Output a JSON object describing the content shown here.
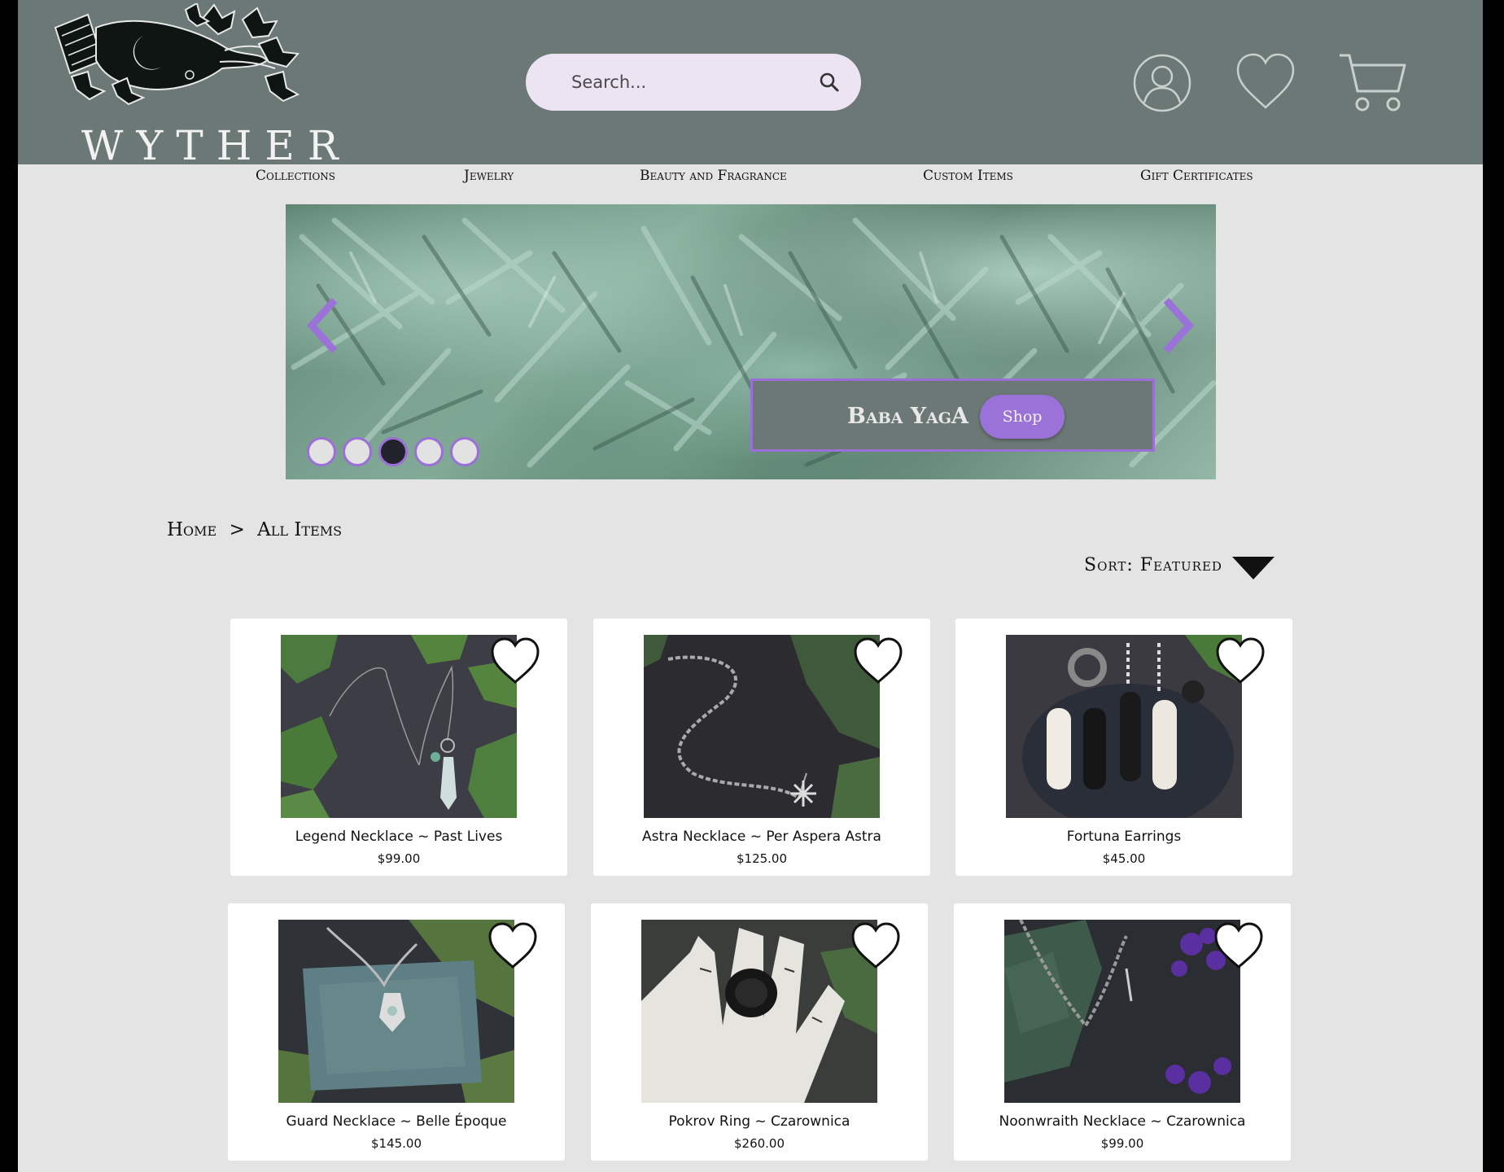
{
  "brand": {
    "name": "WYTHER"
  },
  "search": {
    "placeholder": "Search..."
  },
  "nav": {
    "items": [
      "Collections",
      "Jewelry",
      "Beauty and Fragrance",
      "Custom Items",
      "Gift Certificates"
    ]
  },
  "hero": {
    "title": "Baba YagA",
    "button_label": "Shop",
    "slide_count": 5,
    "active_slide": 3
  },
  "breadcrumb": {
    "home": "Home",
    "separator": ">",
    "current": "All Items"
  },
  "sort": {
    "label": "Sort: Featured"
  },
  "products": [
    {
      "name": "Legend Necklace ~ Past Lives",
      "price": "$99.00"
    },
    {
      "name": "Astra Necklace ~ Per Aspera Astra",
      "price": "$125.00"
    },
    {
      "name": "Fortuna Earrings",
      "price": "$45.00"
    },
    {
      "name": "Guard Necklace ~ Belle Époque",
      "price": "$145.00"
    },
    {
      "name": "Pokrov Ring ~ Czarownica",
      "price": "$260.00"
    },
    {
      "name": "Noonwraith Necklace ~ Czarownica",
      "price": "$99.00"
    }
  ],
  "colors": {
    "header_bg": "#6b7875",
    "page_bg": "#e4e4e4",
    "accent_purple": "#9a72d8",
    "search_bg": "#ece4f3"
  },
  "icons": {
    "search": "search-icon",
    "account": "account-icon",
    "wishlist": "heart-icon",
    "cart": "cart-icon",
    "prev": "chevron-left-icon",
    "next": "chevron-right-icon",
    "sort": "triangle-down-icon"
  }
}
